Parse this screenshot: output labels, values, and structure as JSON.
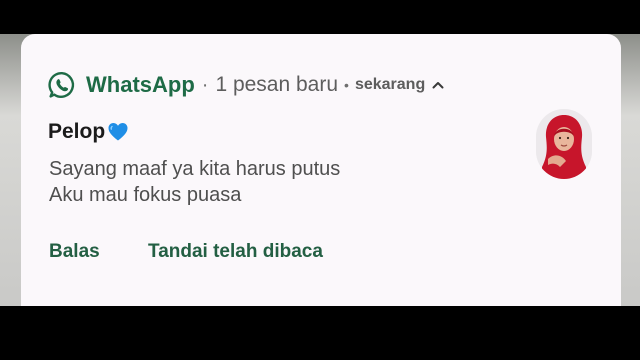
{
  "notification": {
    "app_name": "WhatsApp",
    "separator": "·",
    "summary": "1 pesan baru",
    "time_separator": "•",
    "time": "sekarang",
    "expand_icon": "chevron-up-icon",
    "app_icon": "whatsapp-icon",
    "sender": "Pelop",
    "sender_emoji": "blue-heart-icon",
    "messages": [
      "Sayang maaf ya kita harus putus",
      "Aku mau fokus puasa"
    ],
    "actions": {
      "reply_label": "Balas",
      "mark_read_label": "Tandai telah dibaca"
    }
  },
  "colors": {
    "accent": "#1e6b46",
    "card_background": "#fbf8fb",
    "heart": "#1f8ee6",
    "hijab": "#c7152b"
  }
}
